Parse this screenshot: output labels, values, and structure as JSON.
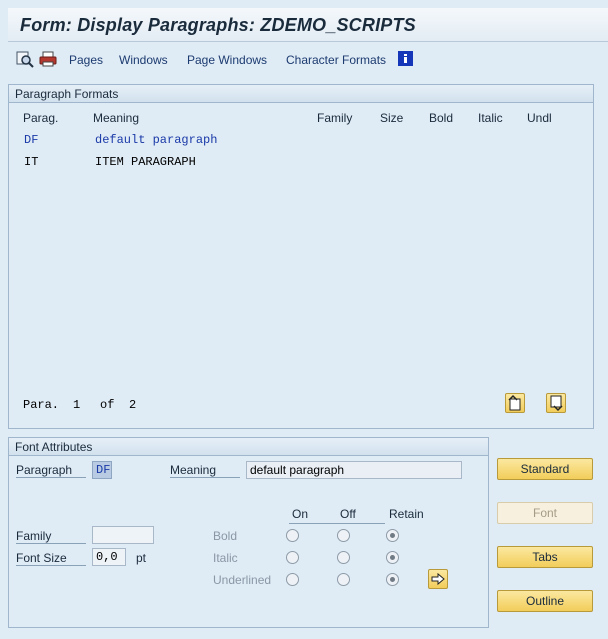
{
  "window": {
    "title": "Form: Display Paragraphs: ZDEMO_SCRIPTS"
  },
  "toolbar": {
    "icons": [
      "display-icon",
      "print-icon"
    ],
    "links": [
      "Pages",
      "Windows",
      "Page Windows",
      "Character Formats"
    ],
    "info_icon": "info-icon"
  },
  "paragraph_formats": {
    "title": "Paragraph Formats",
    "columns": [
      "Parag.",
      "Meaning",
      "Family",
      "Size",
      "Bold",
      "Italic",
      "Undl"
    ],
    "rows": [
      {
        "parag": "DF",
        "meaning": "default paragraph"
      },
      {
        "parag": "IT",
        "meaning": "ITEM PARAGRAPH"
      }
    ],
    "pager": {
      "label": "Para.",
      "current": "1",
      "of": "of",
      "total": "2"
    }
  },
  "font_attributes": {
    "title": "Font Attributes",
    "paragraph_label": "Paragraph",
    "paragraph_value": "DF",
    "meaning_label": "Meaning",
    "meaning_value": "default paragraph",
    "col_on": "On",
    "col_off": "Off",
    "col_retain": "Retain",
    "family_label": "Family",
    "family_value": "",
    "font_size_label": "Font Size",
    "font_size_value": "0,0",
    "font_size_unit": "pt",
    "bold_label": "Bold",
    "italic_label": "Italic",
    "underlined_label": "Underlined",
    "selected": {
      "bold": "Retain",
      "italic": "Retain",
      "underlined": "Retain"
    }
  },
  "buttons": {
    "standard": "Standard",
    "font": "Font",
    "tabs": "Tabs",
    "outline": "Outline"
  },
  "colors": {
    "accent_button": "#f2cd5a",
    "link": "#1c3b70",
    "background": "#dfebf5"
  }
}
